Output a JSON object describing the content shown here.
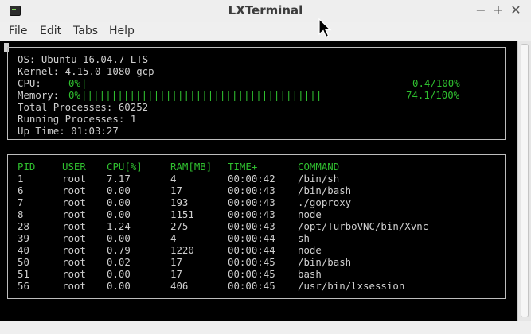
{
  "window": {
    "title": "LXTerminal",
    "min": "−",
    "max": "+",
    "close": "✕"
  },
  "menu": [
    "File",
    "Edit",
    "Tabs",
    "Help"
  ],
  "system": {
    "os": "OS: Ubuntu 16.04.7 LTS",
    "kernel": "Kernel: 4.15.0-1080-gcp",
    "cpu_label": "CPU:",
    "cpu_pct": "0%",
    "cpu_bar": "|",
    "cpu_value": "0.4/100%",
    "mem_label": "Memory:",
    "mem_pct": "0%",
    "mem_bar": "||||||||||||||||||||||||||||||||||||||||",
    "mem_value": "74.1/100%",
    "total": "Total Processes: 60252",
    "running": "Running Processes: 1",
    "uptime": "Up Time: 01:03:27"
  },
  "processes": {
    "headers": [
      "PID",
      "USER",
      "CPU[%]",
      "RAM[MB]",
      "TIME+",
      "COMMAND"
    ],
    "rows": [
      [
        "1",
        "root",
        "7.17",
        "4",
        "00:00:42",
        "/bin/sh"
      ],
      [
        "6",
        "root",
        "0.00",
        "17",
        "00:00:43",
        "/bin/bash"
      ],
      [
        "7",
        "root",
        "0.00",
        "193",
        "00:00:43",
        "./goproxy"
      ],
      [
        "8",
        "root",
        "0.00",
        "1151",
        "00:00:43",
        "node"
      ],
      [
        "28",
        "root",
        "1.24",
        "275",
        "00:00:43",
        "/opt/TurboVNC/bin/Xvnc"
      ],
      [
        "39",
        "root",
        "0.00",
        "4",
        "00:00:44",
        "sh"
      ],
      [
        "40",
        "root",
        "0.79",
        "1220",
        "00:00:44",
        "node"
      ],
      [
        "50",
        "root",
        "0.02",
        "17",
        "00:00:45",
        "/bin/bash"
      ],
      [
        "51",
        "root",
        "0.00",
        "17",
        "00:00:45",
        "bash"
      ],
      [
        "56",
        "root",
        "0.00",
        "406",
        "00:00:45",
        "/usr/bin/lxsession"
      ]
    ]
  },
  "colors": {
    "terminal_bg": "#000000",
    "text": "#cfcfcf",
    "accent_green": "#2fbf2f"
  }
}
